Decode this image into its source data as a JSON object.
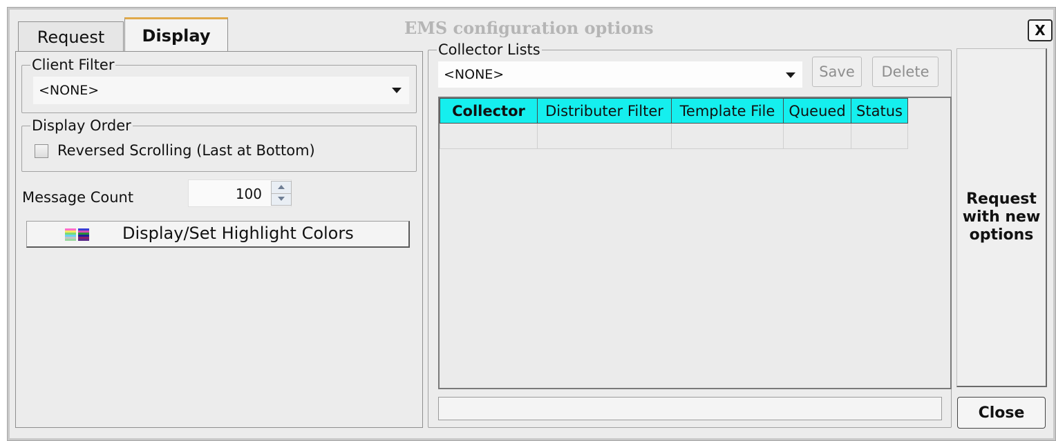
{
  "window": {
    "title": "EMS configuration options",
    "close_label": "X"
  },
  "tabs": [
    {
      "label": "Request",
      "active": false
    },
    {
      "label": "Display",
      "active": true
    }
  ],
  "display": {
    "client_filter": {
      "legend": "Client Filter",
      "value": "<NONE>"
    },
    "display_order": {
      "legend": "Display Order",
      "checkbox_label": "Reversed Scrolling (Last at Bottom)",
      "checked": false
    },
    "message_count": {
      "label": "Message Count",
      "value": "100"
    },
    "highlight_button": {
      "label": "Display/Set Highlight Colors",
      "icon": "color-swatches-icon"
    }
  },
  "collector_lists": {
    "legend": "Collector Lists",
    "selected": "<NONE>",
    "save_label": "Save",
    "delete_label": "Delete",
    "columns": [
      "Collector",
      "Distributer Filter",
      "Template File",
      "Queued",
      "Status"
    ],
    "header_color": "#15efee"
  },
  "actions": {
    "request_label": "Request with new options",
    "close_label": "Close"
  }
}
